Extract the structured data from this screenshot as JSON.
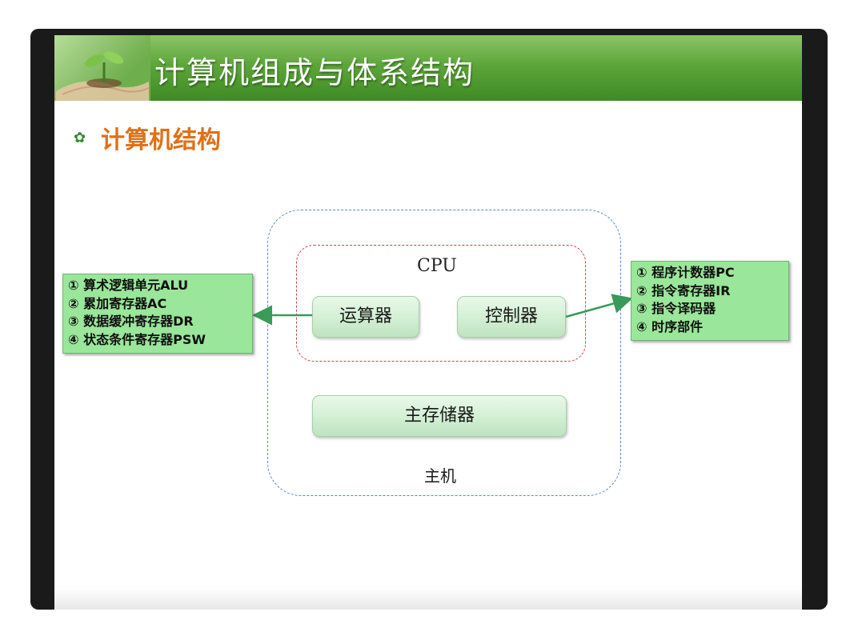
{
  "slide": {
    "title": "计算机组成与体系结构",
    "section_icon": "gear-bullet-icon",
    "section_title": "计算机结构"
  },
  "diagram": {
    "cpu_label": "CPU",
    "alu_label": "运算器",
    "controller_label": "控制器",
    "memory_label": "主存储器",
    "host_label": "主机",
    "alu_components": [
      "① 算术逻辑单元ALU",
      "② 累加寄存器AC",
      "③ 数据缓冲寄存器DR",
      "④ 状态条件寄存器PSW"
    ],
    "controller_components": [
      "① 程序计数器PC",
      "② 指令寄存器IR",
      "③ 指令译码器",
      "④ 时序部件"
    ]
  },
  "colors": {
    "header_green": "#5da63a",
    "section_orange": "#e07018",
    "host_border_blue": "#5a8cc0",
    "cpu_border_red": "#d04050",
    "arrow_green": "#3a9a5a",
    "info_box_green": "#9ae69a"
  }
}
